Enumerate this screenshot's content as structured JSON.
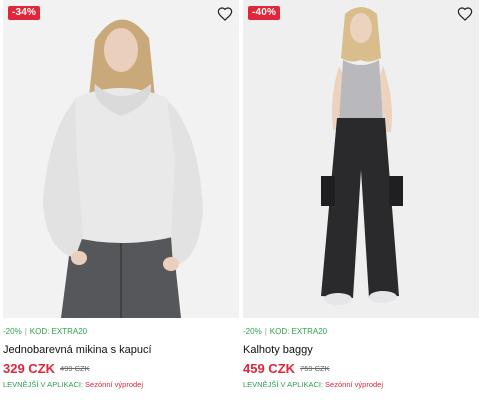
{
  "colors": {
    "accent_red": "#e0263b",
    "promo_green": "#2e9e4f"
  },
  "products": [
    {
      "discount_badge": "-34%",
      "favorite_icon": "heart-outline-icon",
      "promo_discount": "-20%",
      "promo_code": "KOD: EXTRA20",
      "title": "Jednobarevná mikina s kapucí",
      "price": "329 CZK",
      "old_price": "499 CZK",
      "app_note": "LEVNĚJŠÍ V APLIKACI:",
      "sale_label": "Sezónní výprodej"
    },
    {
      "discount_badge": "-40%",
      "favorite_icon": "heart-outline-icon",
      "promo_discount": "-20%",
      "promo_code": "KOD: EXTRA20",
      "title": "Kalhoty baggy",
      "price": "459 CZK",
      "old_price": "759 CZK",
      "app_note": "LEVNĚJŠÍ V APLIKACI:",
      "sale_label": "Sezónní výprodej"
    }
  ]
}
